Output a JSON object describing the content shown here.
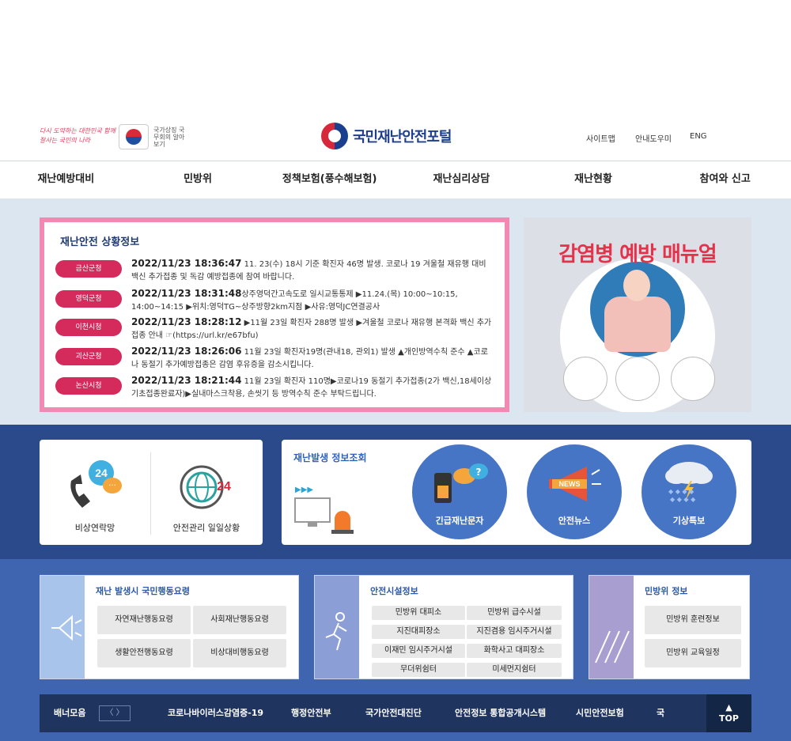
{
  "header": {
    "slogan": "다시 도약하는 대한민국 함께 잘사는 국민의 나라",
    "flag_text": "국가상징 국무회의 알아보기",
    "portal_title": "국민재난안전포털",
    "util": [
      "사이트맵",
      "안내도우미",
      "ENG"
    ]
  },
  "gnb": [
    "재난예방대비",
    "민방위",
    "정책보험(풍수해보험)",
    "재난심리상담",
    "재난현황",
    "참여와 신고"
  ],
  "situation": {
    "title": "재난안전 상황정보",
    "items": [
      {
        "badge": "금산군청",
        "time": "2022/11/23 18:36:47",
        "text": "11. 23(수) 18시 기준 확진자 46명 발생. 코로나 19 겨울철 재유행 대비 백신 추가접종 및 독감 예방접종에 참여 바랍니다."
      },
      {
        "badge": "영덕군청",
        "time": "2022/11/23 18:31:48",
        "text": "상주영덕간고속도로 일시교통통제 ▶11.24.(목) 10:00~10:15, 14:00~14:15 ▶위치:영덕TG~상주방향2km지점 ▶사유:영덕JC연결공사"
      },
      {
        "badge": "이천시청",
        "time": "2022/11/23 18:28:12",
        "text": "▶11월 23일 확진자 288명 발생 ▶겨울철 코로나 재유행 본격화 백신 추가접종 안내 ☞(https://url.kr/e67bfu)"
      },
      {
        "badge": "괴산군청",
        "time": "2022/11/23 18:26:06",
        "text": "11월 23일 확진자19명(관내18, 관외1) 발생 ▲개인방역수칙 준수 ▲코로나 동절기 추가예방접종은 감염 후유증을 감소시킵니다."
      },
      {
        "badge": "논산시청",
        "time": "2022/11/23 18:21:44",
        "text": "11월 23일 확진자 110명▶코로나19 동절기 추가접종(2가 백신,18세이상 기초접종완료자)▶실내마스크착용, 손씻기 등 방역수칙 준수 부탁드립니다."
      }
    ]
  },
  "manual": {
    "title": "감염병 예방 매뉴얼"
  },
  "services_left": [
    {
      "label": "비상연락망",
      "icon": "phone-24-icon"
    },
    {
      "label": "안전관리 일일상황",
      "icon": "globe-24-icon"
    }
  ],
  "services_right": {
    "title": "재난발생 정보조회",
    "items": [
      {
        "label": "긴급재난문자",
        "icon": "walkie-talkie-icon"
      },
      {
        "label": "안전뉴스",
        "icon": "megaphone-news-icon"
      },
      {
        "label": "기상특보",
        "icon": "cloud-rain-icon"
      }
    ]
  },
  "info": {
    "conduct": {
      "title": "재난 발생시 국민행동요령",
      "items": [
        "자연재난행동요령",
        "사회재난행동요령",
        "생활안전행동요령",
        "비상대비행동요령"
      ]
    },
    "facility": {
      "title": "안전시설정보",
      "items": [
        "민방위 대피소",
        "민방위 급수시설",
        "지진대피장소",
        "지진겸용 임시주거시설",
        "이재민 임시주거시설",
        "화학사고 대피장소",
        "무더위쉼터",
        "미세먼지쉼터"
      ]
    },
    "civil": {
      "title": "민방위 정보",
      "items": [
        "민방위 훈련정보",
        "민방위 교육일정"
      ]
    }
  },
  "banner": {
    "title": "배너모음",
    "arrows": "〈  〉",
    "items": [
      "코로나바이러스감염증-19",
      "행정안전부",
      "국가안전대진단",
      "안전정보 통합공개시스템",
      "시민안전보험",
      "국"
    ],
    "top_label": "TOP"
  },
  "colors": {
    "accent": "#2b4a8b",
    "badge": "#d52b5c",
    "border_pink": "#f189b2"
  }
}
